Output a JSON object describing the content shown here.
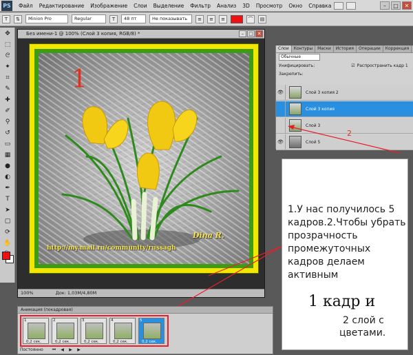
{
  "app": {
    "logo": "PS"
  },
  "menu": [
    "Файл",
    "Редактирование",
    "Изображение",
    "Слои",
    "Выделение",
    "Фильтр",
    "Анализ",
    "3D",
    "Просмотр",
    "Окно",
    "Справка"
  ],
  "options": {
    "tool_icon": "T",
    "font": "Minion Pro",
    "style": "Regular",
    "size": "48 пт",
    "antialias": "Не показывать",
    "text_color": "#ee1111"
  },
  "document": {
    "title": "Без имени-1 @ 100% (Слой 3 копия, RGB/8) *",
    "zoom": "100%",
    "docsize": "Док: 1,03M/4,80M",
    "big_label": "1",
    "url_text": "http://my.mail.ru/community/russagh",
    "signature": "Dina R."
  },
  "layers_panel": {
    "tabs": [
      "Слои",
      "Контуры",
      "Маски",
      "История",
      "Операции",
      "Коррекция"
    ],
    "blend_mode": "Обычные",
    "unify_label": "Унифицировать:",
    "propagate_label": "Распространить кадр 1",
    "lock_label": "Закрепить:",
    "layers": [
      {
        "name": "Слой 3 копия 2",
        "visible": true,
        "selected": false
      },
      {
        "name": "Слой 3 копия",
        "visible": false,
        "selected": true
      },
      {
        "name": "Слой 3",
        "visible": false,
        "selected": false
      },
      {
        "name": "Слой 5",
        "visible": true,
        "selected": false
      }
    ]
  },
  "annotation_label_2": "2",
  "note": {
    "line1": "1.У нас получилось 5 кадров.2.Чтобы убрать прозрачность промежуточных кадров делаем активным",
    "line2": "1 кадр и",
    "line3": "2 слой с",
    "line4": "цветами."
  },
  "animation": {
    "title": "Анимация (покадровая)",
    "loop": "Постоянно",
    "frames": [
      {
        "num": "1",
        "delay": "0,2 сек.",
        "selected": false
      },
      {
        "num": "2",
        "delay": "0,2 сек.",
        "selected": false
      },
      {
        "num": "3",
        "delay": "0,2 сек.",
        "selected": false
      },
      {
        "num": "4",
        "delay": "0,2 сек.",
        "selected": false
      },
      {
        "num": "5",
        "delay": "0,2 сек.",
        "selected": true
      }
    ]
  },
  "colors": {
    "accent_red": "#e6202a",
    "selection_blue": "#2a8fde",
    "frame_yellow": "#f3e600",
    "frame_green": "#3d9c12"
  }
}
